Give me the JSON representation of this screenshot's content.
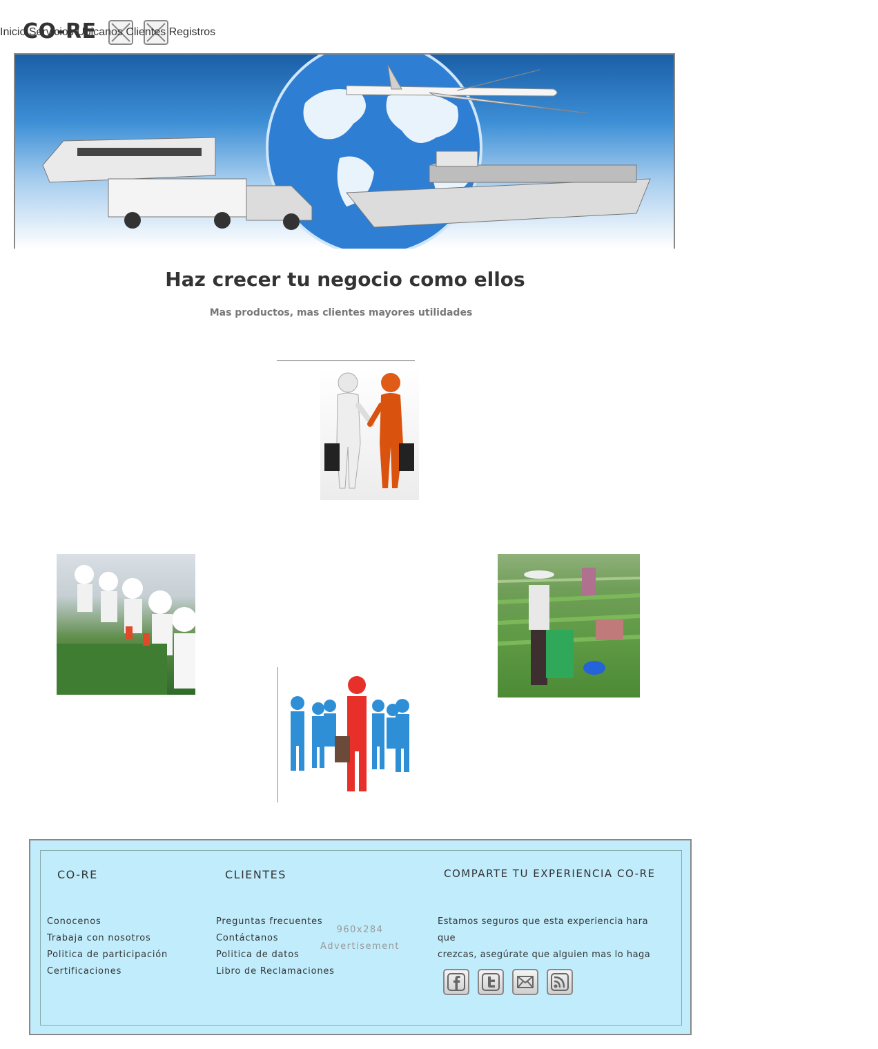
{
  "header": {
    "logo": "CO-RE",
    "nav": [
      {
        "label": "Inicio"
      },
      {
        "label": "Servicios"
      },
      {
        "label": "Ubicanos"
      },
      {
        "label": "Clientes"
      },
      {
        "label": "Registros"
      }
    ]
  },
  "main": {
    "heading": "Haz crecer tu negocio como ellos",
    "subheading": "Mas productos, mas clientes mayores utilidades"
  },
  "footer": {
    "col1": {
      "title": "CO-RE",
      "links": [
        "Conocenos",
        "Trabaja con nosotros",
        "Politica de participación",
        "Certificaciones"
      ]
    },
    "col2": {
      "title": "CLIENTES",
      "links": [
        "Preguntas  frecuentes",
        "Contáctanos",
        "Politica de datos",
        "Libro de Reclamaciones"
      ]
    },
    "ad": {
      "size": "960x284",
      "label": "Advertisement"
    },
    "col3": {
      "title": "COMPARTE TU EXPERIENCIA CO-RE",
      "text_line1": "Estamos seguros que esta experiencia hara que",
      "text_line2": "crezcas, asegúrate que alguien mas lo haga"
    },
    "social_icons": [
      "facebook-icon",
      "twitter-icon",
      "mail-icon",
      "rss-icon"
    ]
  },
  "colors": {
    "footer_bg": "#c0ecfc",
    "hero_blue": "#1a5fa8",
    "text": "#333333",
    "subtext": "#777777"
  }
}
